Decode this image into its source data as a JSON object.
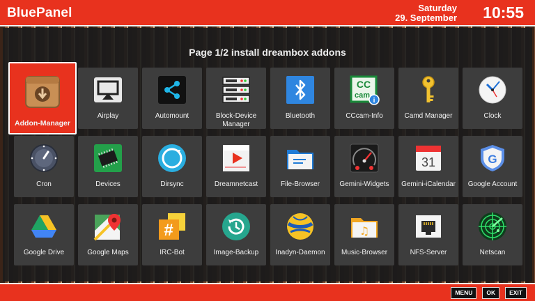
{
  "header": {
    "brand": "BluePanel",
    "day": "Saturday",
    "date": "29. September",
    "time": "10:55"
  },
  "page_title": "Page 1/2 install dreambox addons",
  "tiles": [
    {
      "label": "Addon-Manager",
      "icon": "addon-manager-icon",
      "selected": true
    },
    {
      "label": "Airplay",
      "icon": "airplay-icon"
    },
    {
      "label": "Automount",
      "icon": "share-icon"
    },
    {
      "label": "Block-Device Manager",
      "icon": "server-icon"
    },
    {
      "label": "Bluetooth",
      "icon": "bluetooth-icon"
    },
    {
      "label": "CCcam-Info",
      "icon": "cccam-icon",
      "icon_text": "CC cam"
    },
    {
      "label": "Camd Manager",
      "icon": "key-icon"
    },
    {
      "label": "Clock",
      "icon": "clock-icon"
    },
    {
      "label": "Cron",
      "icon": "dial-icon"
    },
    {
      "label": "Devices",
      "icon": "chip-icon"
    },
    {
      "label": "Dirsync",
      "icon": "sync-icon"
    },
    {
      "label": "Dreamnetcast",
      "icon": "play-icon"
    },
    {
      "label": "File-Browser",
      "icon": "folder-icon"
    },
    {
      "label": "Gemini-Widgets",
      "icon": "gauge-icon"
    },
    {
      "label": "Gemini-iCalendar",
      "icon": "calendar-icon",
      "icon_text": "31"
    },
    {
      "label": "Google Account",
      "icon": "google-shield-icon",
      "icon_text": "G"
    },
    {
      "label": "Google Drive",
      "icon": "google-drive-icon"
    },
    {
      "label": "Google Maps",
      "icon": "google-maps-icon"
    },
    {
      "label": "IRC-Bot",
      "icon": "hashtag-icon",
      "icon_text": "#"
    },
    {
      "label": "Image-Backup",
      "icon": "backup-icon"
    },
    {
      "label": "Inadyn-Daemon",
      "icon": "inadyn-ball-icon"
    },
    {
      "label": "Music-Browser",
      "icon": "music-folder-icon",
      "icon_text": "♫"
    },
    {
      "label": "NFS-Server",
      "icon": "ethernet-port-icon"
    },
    {
      "label": "Netscan",
      "icon": "radar-icon"
    }
  ],
  "footer": {
    "menu": "MENU",
    "ok": "OK",
    "exit": "EXIT"
  },
  "colors": {
    "accent": "#e8321e",
    "panel": "#1c1c1c",
    "tile": "#3d3d3d"
  }
}
